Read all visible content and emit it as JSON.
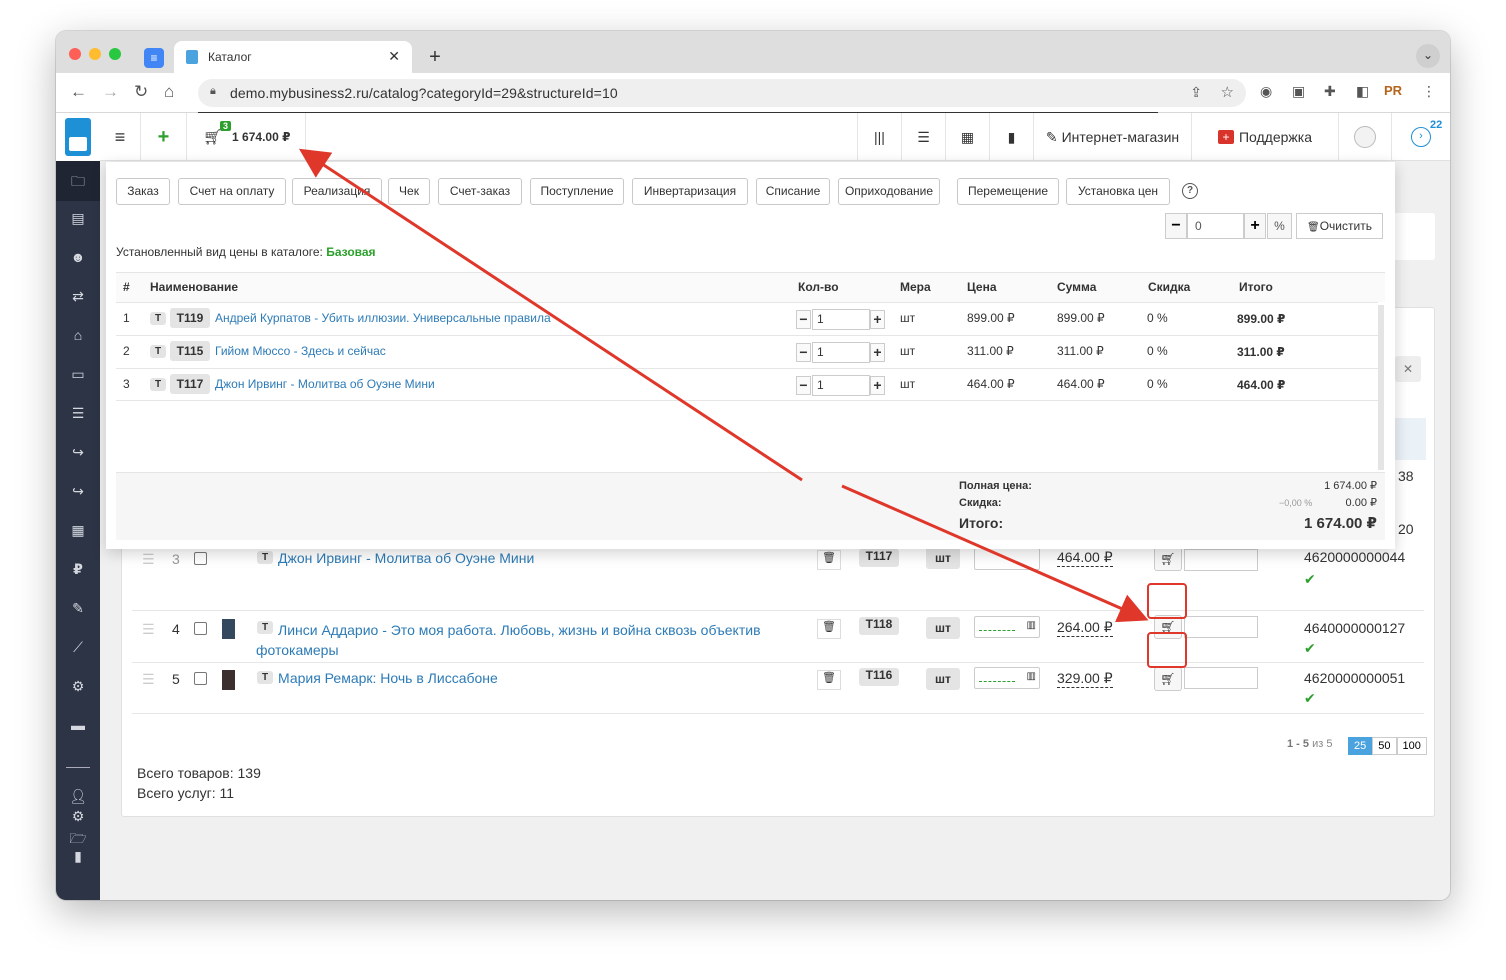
{
  "browser": {
    "tab_title": "Каталог",
    "url": "demo.mybusiness2.ru/catalog?categoryId=29&structureId=10",
    "ext_pr": "PR",
    "colors": {
      "close": "#fe5f57",
      "minimize": "#febc2e",
      "maximize": "#28c840"
    }
  },
  "topbar": {
    "cart_count": "3",
    "cart_total": "1 674.00 ₽",
    "shop_label": "Интернет-магазин",
    "support_label": "Поддержка",
    "notif_count": "22"
  },
  "popup": {
    "doc_buttons": [
      "Заказ",
      "Счет на оплату",
      "Реализация",
      "Чек",
      "Счет-заказ",
      "Поступление",
      "Инвертаризация",
      "Списание",
      "Оприходование",
      "Перемещение",
      "Установка цен"
    ],
    "discount_value": "0",
    "percent_label": "%",
    "clear_label": "Очистить",
    "price_type_label": "Установленный вид цены в каталоге:",
    "price_type_value": "Базовая",
    "columns": [
      "#",
      "Наименование",
      "Кол-во",
      "Мера",
      "Цена",
      "Сумма",
      "Скидка",
      "Итого"
    ],
    "rows": [
      {
        "num": "1",
        "type": "T",
        "code": "T119",
        "name": "Андрей Курпатов - Убить иллюзии. Универсальные правила",
        "qty": "1",
        "unit": "шт",
        "price": "899.00 ₽",
        "sum": "899.00 ₽",
        "discount": "0 %",
        "total": "899.00 ₽"
      },
      {
        "num": "2",
        "type": "T",
        "code": "T115",
        "name": "Гийом Мюссо - Здесь и сейчас",
        "qty": "1",
        "unit": "шт",
        "price": "311.00 ₽",
        "sum": "311.00 ₽",
        "discount": "0 %",
        "total": "311.00 ₽"
      },
      {
        "num": "3",
        "type": "T",
        "code": "T117",
        "name": "Джон Ирвинг - Молитва об Оуэне Мини",
        "qty": "1",
        "unit": "шт",
        "price": "464.00 ₽",
        "sum": "464.00 ₽",
        "discount": "0 %",
        "total": "464.00 ₽"
      }
    ],
    "summary": {
      "full_label": "Полная цена:",
      "full_value": "1 674.00 ₽",
      "discount_label": "Скидка:",
      "discount_pct": "−0,00 %",
      "discount_value": "0.00 ₽",
      "total_label": "Итого:",
      "total_value": "1 674.00 ₽"
    }
  },
  "catalog": {
    "partial_row": {
      "num": "3",
      "type": "T",
      "name": "Джон Ирвинг - Молитва об Оуэне Мини",
      "code": "T117",
      "unit": "шт",
      "price": "464.00 ₽",
      "barcode": "4620000000044"
    },
    "right_fragments": [
      "38",
      "20"
    ],
    "rows": [
      {
        "num": "4",
        "type": "T",
        "name": "Линси Аддарио - Это моя работа. Любовь, жизнь и война сквозь объектив фотокамеры",
        "code": "T118",
        "unit": "шт",
        "price": "264.00 ₽",
        "barcode": "4640000000127"
      },
      {
        "num": "5",
        "type": "T",
        "name": "Мария Ремарк: Ночь в Лиссабоне",
        "code": "T116",
        "unit": "шт",
        "price": "329.00 ₽",
        "barcode": "4620000000051"
      }
    ],
    "pager": {
      "range": "1 - 5",
      "of": "из 5",
      "sizes": [
        "25",
        "50",
        "100"
      ]
    },
    "total_goods": "Всего товаров: 139",
    "total_services": "Всего услуг: 11"
  }
}
